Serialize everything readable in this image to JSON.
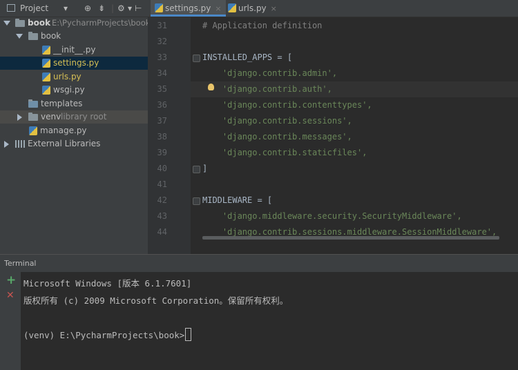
{
  "project_panel": {
    "view_label": "Project",
    "tree": [
      {
        "label": "book",
        "path": "E:\\PycharmProjects\\book"
      },
      {
        "label": "book"
      },
      {
        "label": "__init__.py"
      },
      {
        "label": "settings.py"
      },
      {
        "label": "urls.py"
      },
      {
        "label": "wsgi.py"
      },
      {
        "label": "templates"
      },
      {
        "label": "venv",
        "note": "library root"
      },
      {
        "label": "manage.py"
      },
      {
        "label": "External Libraries"
      }
    ]
  },
  "editor": {
    "tabs": [
      {
        "label": "settings.py",
        "close": "×"
      },
      {
        "label": "urls.py",
        "close": "×"
      }
    ],
    "lines": [
      {
        "num": "31",
        "text": "# Application definition"
      },
      {
        "num": "32",
        "text": ""
      },
      {
        "num": "33",
        "text": "INSTALLED_APPS = ["
      },
      {
        "num": "34",
        "text": "    'django.contrib.admin',"
      },
      {
        "num": "35",
        "text": "    'django.contrib.auth',"
      },
      {
        "num": "36",
        "text": "    'django.contrib.contenttypes',"
      },
      {
        "num": "37",
        "text": "    'django.contrib.sessions',"
      },
      {
        "num": "38",
        "text": "    'django.contrib.messages',"
      },
      {
        "num": "39",
        "text": "    'django.contrib.staticfiles',"
      },
      {
        "num": "40",
        "text": "]"
      },
      {
        "num": "41",
        "text": ""
      },
      {
        "num": "42",
        "text": "MIDDLEWARE = ["
      },
      {
        "num": "43",
        "text": "    'django.middleware.security.SecurityMiddleware',"
      },
      {
        "num": "44",
        "text": "    'django.contrib.sessions.middleware.SessionMiddleware',"
      }
    ]
  },
  "terminal": {
    "title": "Terminal",
    "add_icon": "+",
    "close_icon": "✕",
    "lines": [
      "Microsoft Windows [版本 6.1.7601]",
      "版权所有 (c) 2009 Microsoft Corporation。保留所有权利。",
      "",
      "(venv) E:\\PycharmProjects\\book>"
    ]
  },
  "colors": {
    "panel_bg": "#3c3f41",
    "editor_bg": "#2b2b2b",
    "selection": "#0d293e",
    "string": "#6a8759",
    "comment": "#808080"
  }
}
